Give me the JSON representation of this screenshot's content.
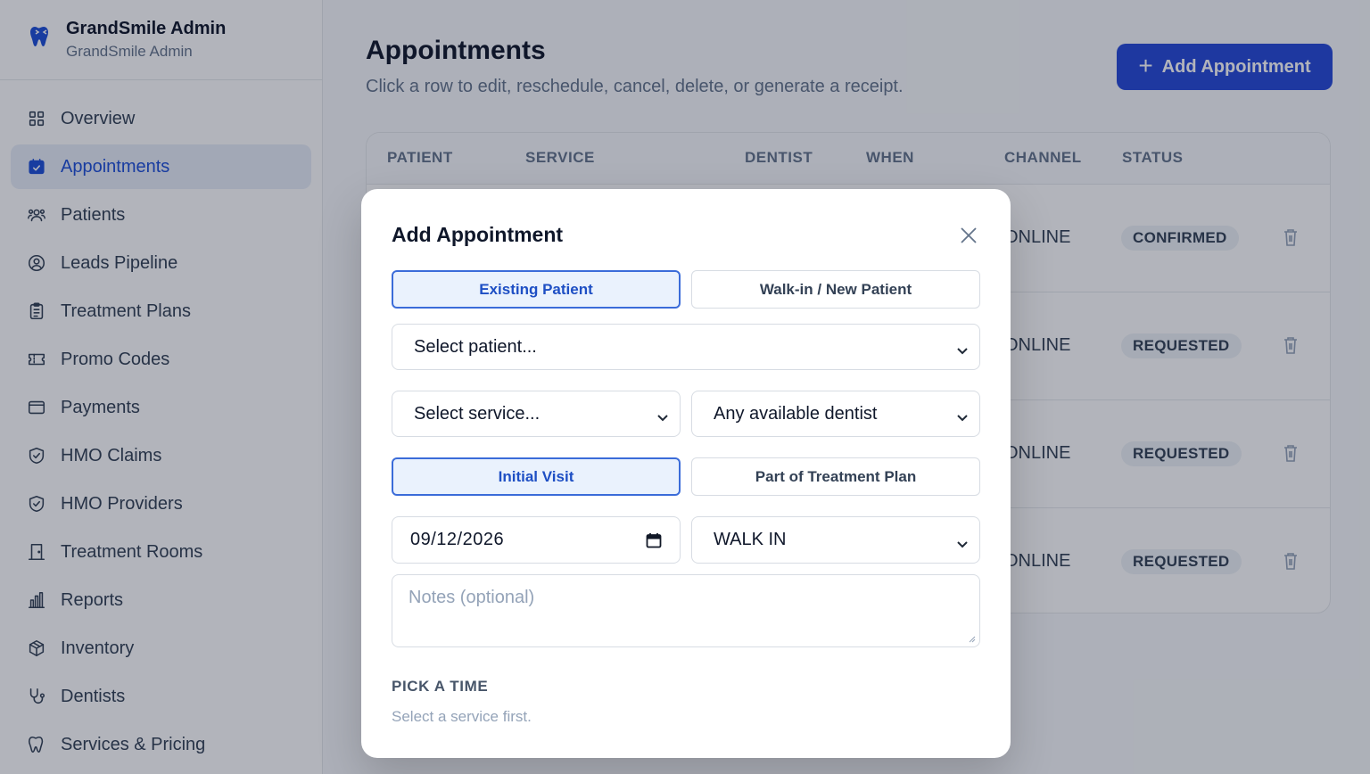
{
  "brand": {
    "name": "GrandSmile Admin",
    "subtitle": "GrandSmile Admin"
  },
  "sidebar": {
    "items": [
      {
        "label": "Overview",
        "icon": "grid-icon",
        "active": false
      },
      {
        "label": "Appointments",
        "icon": "calendar-check-icon",
        "active": true
      },
      {
        "label": "Patients",
        "icon": "users-icon",
        "active": false
      },
      {
        "label": "Leads Pipeline",
        "icon": "user-circle-icon",
        "active": false
      },
      {
        "label": "Treatment Plans",
        "icon": "clipboard-icon",
        "active": false
      },
      {
        "label": "Promo Codes",
        "icon": "ticket-icon",
        "active": false
      },
      {
        "label": "Payments",
        "icon": "wallet-icon",
        "active": false
      },
      {
        "label": "HMO Claims",
        "icon": "shield-check-icon",
        "active": false
      },
      {
        "label": "HMO Providers",
        "icon": "shield-check-icon",
        "active": false
      },
      {
        "label": "Treatment Rooms",
        "icon": "door-icon",
        "active": false
      },
      {
        "label": "Reports",
        "icon": "bar-chart-icon",
        "active": false
      },
      {
        "label": "Inventory",
        "icon": "package-icon",
        "active": false
      },
      {
        "label": "Dentists",
        "icon": "stethoscope-icon",
        "active": false
      },
      {
        "label": "Services & Pricing",
        "icon": "tooth-icon",
        "active": false
      }
    ]
  },
  "header": {
    "title": "Appointments",
    "subtitle": "Click a row to edit, reschedule, cancel, delete, or generate a receipt.",
    "add_button": "Add Appointment"
  },
  "table": {
    "columns": [
      "PATIENT",
      "SERVICE",
      "DENTIST",
      "WHEN",
      "CHANNEL",
      "STATUS"
    ],
    "rows": [
      {
        "channel": "ONLINE",
        "status": "CONFIRMED"
      },
      {
        "channel": "ONLINE",
        "status": "REQUESTED"
      },
      {
        "channel": "ONLINE",
        "status": "REQUESTED"
      },
      {
        "channel": "ONLINE",
        "status": "REQUESTED"
      }
    ]
  },
  "modal": {
    "title": "Add Appointment",
    "patient_type_options": [
      "Existing Patient",
      "Walk-in / New Patient"
    ],
    "patient_select": "Select patient...",
    "service_select": "Select service...",
    "dentist_select": "Any available dentist",
    "visit_type_options": [
      "Initial Visit",
      "Part of Treatment Plan"
    ],
    "date_value": "09/12/2026",
    "channel_select": "WALK IN",
    "notes_placeholder": "Notes (optional)",
    "pick_time_label": "PICK A TIME",
    "pick_time_hint": "Select a service first."
  },
  "colors": {
    "accent": "#2549d8",
    "active_bg": "#e8eef8",
    "active_text": "#1d4ed8"
  }
}
